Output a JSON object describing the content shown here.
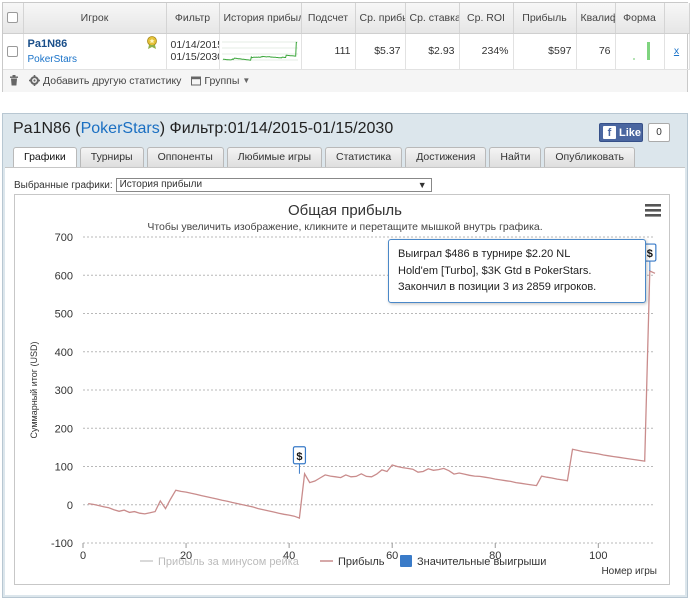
{
  "stats_table": {
    "columns": [
      "",
      "Игрок",
      "Фильтр",
      "История прибыли",
      "Подсчет",
      "Ср. прибыль",
      "Ср. ставка",
      "Ср. ROI",
      "Прибыль",
      "Квалиф.",
      "Форма",
      ""
    ],
    "row": {
      "player_name": "Pa1N86",
      "site": "PokerStars",
      "filter_from": "01/14/2015",
      "filter_to": "01/15/2030",
      "count": "111",
      "avg_profit": "$5.37",
      "avg_stake": "$2.93",
      "avg_roi": "234%",
      "profit": "$597",
      "ability": "76",
      "remove": "x"
    },
    "footer": {
      "add_stat_label": "Добавить другую статистику",
      "groups_label": "Группы"
    }
  },
  "player_panel": {
    "title_name": "Pa1N86",
    "title_site": "PokerStars",
    "title_filter": "Фильтр:01/14/2015-01/15/2030",
    "like_label": "Like",
    "like_count": "0",
    "tabs": [
      "Графики",
      "Турниры",
      "Оппоненты",
      "Любимые игры",
      "Статистика",
      "Достижения",
      "Найти",
      "Опубликовать"
    ],
    "active_tab": 0,
    "chart_select_label": "Выбранные графики:",
    "chart_select_value": "История прибыли"
  },
  "chart_data": {
    "type": "line",
    "title": "Общая прибыль",
    "subtitle": "Чтобы увеличить изображение, кликните и перетащите мышкой внутрь графика.",
    "xlabel": "Номер игры",
    "ylabel": "Суммарный итог (USD)",
    "xlim": [
      0,
      111
    ],
    "ylim": [
      -100,
      700
    ],
    "xticks": [
      0,
      20,
      40,
      60,
      80,
      100
    ],
    "yticks": [
      -100,
      0,
      100,
      200,
      300,
      400,
      500,
      600,
      700
    ],
    "legend": [
      "Прибыль за минусом рейка",
      "Прибыль",
      "Значительные выигрыши"
    ],
    "legend_placement": "bottom",
    "colors": {
      "profit": "#c98c8c",
      "rake": "#cccccc",
      "bigwins": "#3a7bc8",
      "grid": "#b8b8b8"
    },
    "series": [
      {
        "name": "Прибыль",
        "x": [
          1,
          2,
          3,
          4,
          5,
          6,
          7,
          8,
          9,
          10,
          11,
          12,
          13,
          14,
          15,
          16,
          17,
          18,
          19,
          20,
          21,
          22,
          23,
          24,
          25,
          26,
          27,
          28,
          29,
          30,
          31,
          32,
          33,
          34,
          35,
          36,
          37,
          38,
          39,
          40,
          41,
          42,
          43,
          44,
          45,
          46,
          47,
          48,
          49,
          50,
          51,
          52,
          53,
          54,
          55,
          56,
          57,
          58,
          59,
          60,
          61,
          62,
          63,
          64,
          65,
          66,
          67,
          68,
          69,
          70,
          71,
          72,
          73,
          74,
          75,
          76,
          77,
          78,
          79,
          80,
          81,
          82,
          83,
          84,
          85,
          86,
          87,
          88,
          89,
          90,
          91,
          92,
          93,
          94,
          95,
          96,
          97,
          98,
          99,
          100,
          101,
          102,
          103,
          104,
          105,
          106,
          107,
          108,
          109,
          110,
          111
        ],
        "values": [
          3,
          1,
          -2,
          -5,
          -8,
          -13,
          -17,
          -14,
          -20,
          -18,
          -22,
          -24,
          -21,
          -18,
          10,
          -10,
          15,
          38,
          35,
          33,
          30,
          27,
          24,
          21,
          18,
          15,
          12,
          9,
          6,
          3,
          0,
          -3,
          -6,
          -10,
          -13,
          -16,
          -19,
          -22,
          -25,
          -27,
          -30,
          -35,
          81,
          58,
          62,
          70,
          78,
          75,
          73,
          71,
          78,
          73,
          74,
          81,
          74,
          73,
          80,
          91,
          87,
          104,
          100,
          97,
          95,
          93,
          85,
          87,
          94,
          90,
          92,
          95,
          89,
          80,
          83,
          80,
          77,
          75,
          74,
          72,
          70,
          67,
          65,
          63,
          61,
          58,
          56,
          54,
          52,
          50,
          75,
          72,
          70,
          67,
          65,
          63,
          145,
          142,
          139,
          137,
          135,
          133,
          130,
          128,
          126,
          124,
          122,
          120,
          118,
          116,
          114,
          611,
          605
        ],
        "color": "#c98c8c"
      }
    ],
    "big_wins": [
      {
        "x": 42,
        "y": 81
      },
      {
        "x": 110,
        "y": 611
      }
    ],
    "big_win_marker": "$",
    "tooltip": {
      "line1": "Выиграл $486 в турнире $2.20 NL",
      "line2": "Hold'em [Turbo], $3K Gtd в PokerStars.",
      "line3": "Закончил в позиции 3 из 2859 игроков."
    }
  },
  "icons": {
    "trash": "trash-icon",
    "gear": "gear-icon",
    "groups": "groups-icon",
    "menu": "hamburger-menu-icon",
    "badge": "rank-badge-icon"
  }
}
